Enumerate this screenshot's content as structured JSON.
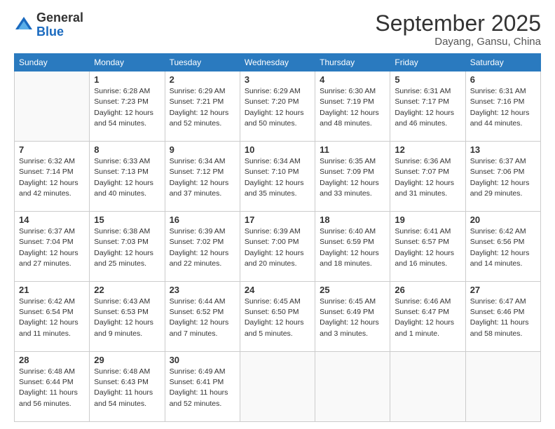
{
  "header": {
    "logo_general": "General",
    "logo_blue": "Blue",
    "month_title": "September 2025",
    "location": "Dayang, Gansu, China"
  },
  "days_of_week": [
    "Sunday",
    "Monday",
    "Tuesday",
    "Wednesday",
    "Thursday",
    "Friday",
    "Saturday"
  ],
  "weeks": [
    [
      {
        "day": "",
        "info": ""
      },
      {
        "day": "1",
        "info": "Sunrise: 6:28 AM\nSunset: 7:23 PM\nDaylight: 12 hours\nand 54 minutes."
      },
      {
        "day": "2",
        "info": "Sunrise: 6:29 AM\nSunset: 7:21 PM\nDaylight: 12 hours\nand 52 minutes."
      },
      {
        "day": "3",
        "info": "Sunrise: 6:29 AM\nSunset: 7:20 PM\nDaylight: 12 hours\nand 50 minutes."
      },
      {
        "day": "4",
        "info": "Sunrise: 6:30 AM\nSunset: 7:19 PM\nDaylight: 12 hours\nand 48 minutes."
      },
      {
        "day": "5",
        "info": "Sunrise: 6:31 AM\nSunset: 7:17 PM\nDaylight: 12 hours\nand 46 minutes."
      },
      {
        "day": "6",
        "info": "Sunrise: 6:31 AM\nSunset: 7:16 PM\nDaylight: 12 hours\nand 44 minutes."
      }
    ],
    [
      {
        "day": "7",
        "info": "Sunrise: 6:32 AM\nSunset: 7:14 PM\nDaylight: 12 hours\nand 42 minutes."
      },
      {
        "day": "8",
        "info": "Sunrise: 6:33 AM\nSunset: 7:13 PM\nDaylight: 12 hours\nand 40 minutes."
      },
      {
        "day": "9",
        "info": "Sunrise: 6:34 AM\nSunset: 7:12 PM\nDaylight: 12 hours\nand 37 minutes."
      },
      {
        "day": "10",
        "info": "Sunrise: 6:34 AM\nSunset: 7:10 PM\nDaylight: 12 hours\nand 35 minutes."
      },
      {
        "day": "11",
        "info": "Sunrise: 6:35 AM\nSunset: 7:09 PM\nDaylight: 12 hours\nand 33 minutes."
      },
      {
        "day": "12",
        "info": "Sunrise: 6:36 AM\nSunset: 7:07 PM\nDaylight: 12 hours\nand 31 minutes."
      },
      {
        "day": "13",
        "info": "Sunrise: 6:37 AM\nSunset: 7:06 PM\nDaylight: 12 hours\nand 29 minutes."
      }
    ],
    [
      {
        "day": "14",
        "info": "Sunrise: 6:37 AM\nSunset: 7:04 PM\nDaylight: 12 hours\nand 27 minutes."
      },
      {
        "day": "15",
        "info": "Sunrise: 6:38 AM\nSunset: 7:03 PM\nDaylight: 12 hours\nand 25 minutes."
      },
      {
        "day": "16",
        "info": "Sunrise: 6:39 AM\nSunset: 7:02 PM\nDaylight: 12 hours\nand 22 minutes."
      },
      {
        "day": "17",
        "info": "Sunrise: 6:39 AM\nSunset: 7:00 PM\nDaylight: 12 hours\nand 20 minutes."
      },
      {
        "day": "18",
        "info": "Sunrise: 6:40 AM\nSunset: 6:59 PM\nDaylight: 12 hours\nand 18 minutes."
      },
      {
        "day": "19",
        "info": "Sunrise: 6:41 AM\nSunset: 6:57 PM\nDaylight: 12 hours\nand 16 minutes."
      },
      {
        "day": "20",
        "info": "Sunrise: 6:42 AM\nSunset: 6:56 PM\nDaylight: 12 hours\nand 14 minutes."
      }
    ],
    [
      {
        "day": "21",
        "info": "Sunrise: 6:42 AM\nSunset: 6:54 PM\nDaylight: 12 hours\nand 11 minutes."
      },
      {
        "day": "22",
        "info": "Sunrise: 6:43 AM\nSunset: 6:53 PM\nDaylight: 12 hours\nand 9 minutes."
      },
      {
        "day": "23",
        "info": "Sunrise: 6:44 AM\nSunset: 6:52 PM\nDaylight: 12 hours\nand 7 minutes."
      },
      {
        "day": "24",
        "info": "Sunrise: 6:45 AM\nSunset: 6:50 PM\nDaylight: 12 hours\nand 5 minutes."
      },
      {
        "day": "25",
        "info": "Sunrise: 6:45 AM\nSunset: 6:49 PM\nDaylight: 12 hours\nand 3 minutes."
      },
      {
        "day": "26",
        "info": "Sunrise: 6:46 AM\nSunset: 6:47 PM\nDaylight: 12 hours\nand 1 minute."
      },
      {
        "day": "27",
        "info": "Sunrise: 6:47 AM\nSunset: 6:46 PM\nDaylight: 11 hours\nand 58 minutes."
      }
    ],
    [
      {
        "day": "28",
        "info": "Sunrise: 6:48 AM\nSunset: 6:44 PM\nDaylight: 11 hours\nand 56 minutes."
      },
      {
        "day": "29",
        "info": "Sunrise: 6:48 AM\nSunset: 6:43 PM\nDaylight: 11 hours\nand 54 minutes."
      },
      {
        "day": "30",
        "info": "Sunrise: 6:49 AM\nSunset: 6:41 PM\nDaylight: 11 hours\nand 52 minutes."
      },
      {
        "day": "",
        "info": ""
      },
      {
        "day": "",
        "info": ""
      },
      {
        "day": "",
        "info": ""
      },
      {
        "day": "",
        "info": ""
      }
    ]
  ]
}
